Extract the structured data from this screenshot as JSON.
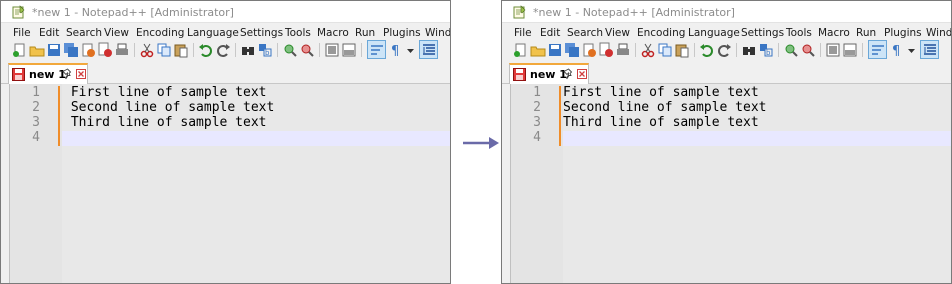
{
  "windows": [
    {
      "title": "*new 1 - Notepad++ [Administrator]",
      "tab_label": "new 1",
      "lines": [
        {
          "num": "1",
          "text": " First line of sample text"
        },
        {
          "num": "2",
          "text": " Second line of sample text"
        },
        {
          "num": "3",
          "text": " Third line of sample text"
        },
        {
          "num": "4",
          "text": ""
        }
      ]
    },
    {
      "title": "*new 1 - Notepad++ [Administrator]",
      "tab_label": "new 1",
      "lines": [
        {
          "num": "1",
          "text": "First line of sample text"
        },
        {
          "num": "2",
          "text": "Second line of sample text"
        },
        {
          "num": "3",
          "text": "Third line of sample text"
        },
        {
          "num": "4",
          "text": ""
        }
      ]
    }
  ],
  "menu": [
    "File",
    "Edit",
    "Search",
    "View",
    "Encoding",
    "Language",
    "Settings",
    "Tools",
    "Macro",
    "Run",
    "Plugins",
    "Windo"
  ],
  "toolbar_icons": [
    "new-file-icon",
    "open-file-icon",
    "save-icon",
    "save-all-icon",
    "close-icon",
    "close-all-icon",
    "print-icon",
    "cut-icon",
    "copy-icon",
    "paste-icon",
    "undo-icon",
    "redo-icon",
    "find-icon",
    "replace-icon",
    "zoom-in-icon",
    "zoom-out-icon",
    "sync-vertical-icon",
    "sync-horizontal-icon",
    "word-wrap-icon",
    "show-all-chars-icon",
    "dropdown-icon",
    "indent-guide-icon"
  ],
  "colors": {
    "tab_accent": "#f2a83c",
    "change_bar": "#f08c28",
    "caret_line": "#e8e8ff",
    "arrow": "#6a6aa8"
  },
  "arrow_icon": "right-arrow-icon"
}
